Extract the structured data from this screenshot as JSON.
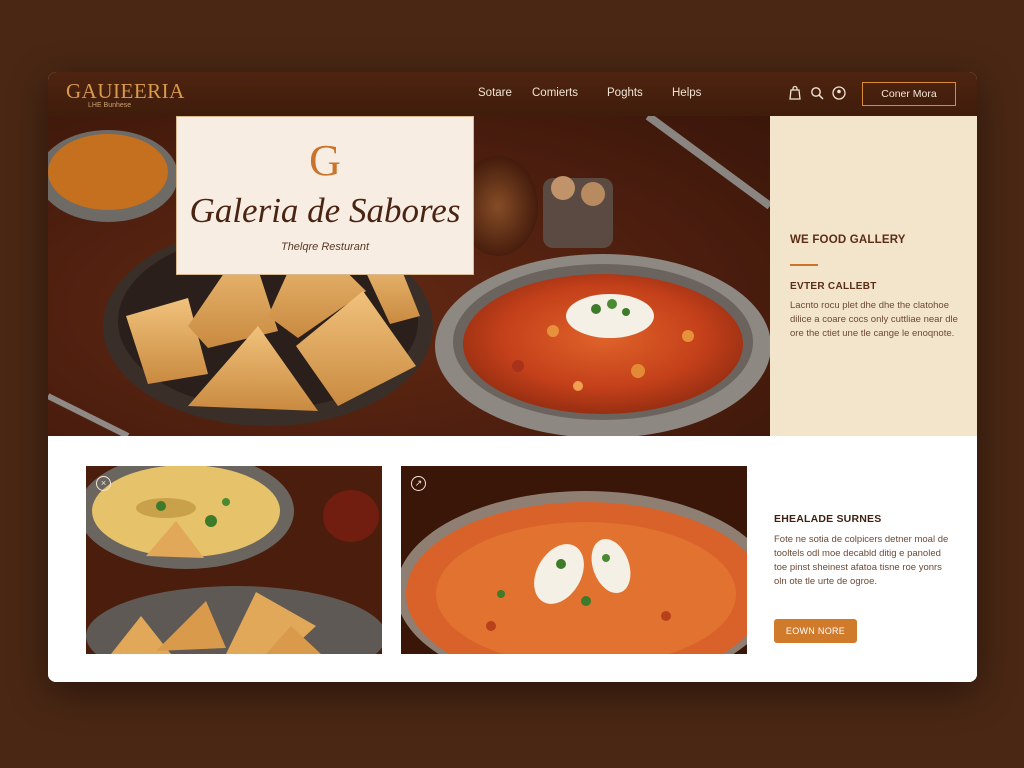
{
  "nav": {
    "logo_main": "GAUIEERIA",
    "logo_sub": "LHE  Bunhese",
    "links": [
      "Sotare",
      "Comierts",
      "Poghts",
      "Helps"
    ],
    "icons": [
      "bag-icon",
      "search-icon",
      "user-icon"
    ],
    "cta_label": "Coner Mora"
  },
  "hero": {
    "monogram": "G",
    "title": "Galeria de Sabores",
    "subtitle": "Thelqre Resturant"
  },
  "side_panel": {
    "heading": "WE FOOD GALLERY",
    "subheading": "EVTER CALLEBT",
    "body": "Lacnto rocu plet dhe dhe the clatohoe dilice a coare cocs only cuttliae near dle ore the ctiet une tle cange le enoqnote."
  },
  "bottom": {
    "thumbs": [
      {
        "icon": "close-icon",
        "glyph": "×"
      },
      {
        "icon": "expand-icon",
        "glyph": "↗"
      }
    ],
    "info_heading": "EHEALADE SURNES",
    "info_body": "Fote ne sotia de colpicers detner moal de tooltels odl moe decabld ditig e panoled toe pinst sheinest afatoa tisne roe yonrs oln ote tle urte de ogroe.",
    "info_button": "EOWN NORE"
  },
  "colors": {
    "background": "#4a2714",
    "nav": "#4e2410",
    "accent": "#c9742a",
    "panel": "#f3e4cc",
    "button": "#d07a2c"
  }
}
